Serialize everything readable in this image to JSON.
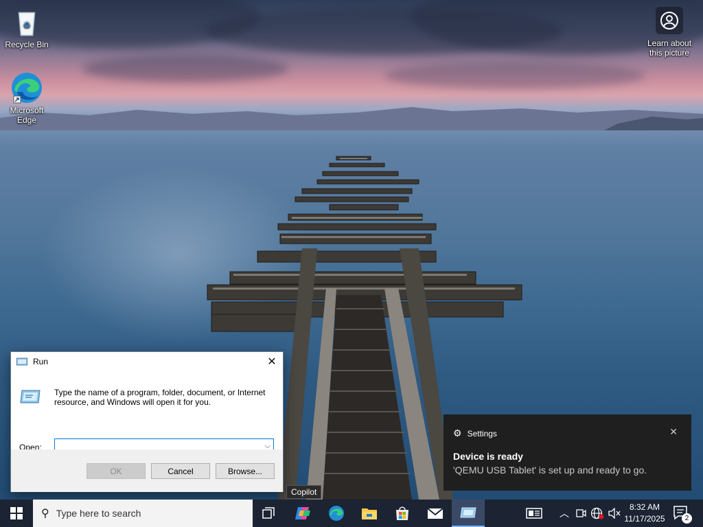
{
  "desktop": {
    "icons": [
      {
        "label": "Recycle Bin"
      },
      {
        "label": "Microsoft Edge"
      },
      {
        "label": "Learn about this picture"
      }
    ]
  },
  "run_dialog": {
    "title": "Run",
    "description": "Type the name of a program, folder, document, or Internet resource, and Windows will open it for you.",
    "open_label_accel": "O",
    "open_label_rest": "pen:",
    "open_value": "",
    "ok_label": "OK",
    "cancel_label": "Cancel",
    "browse_label": "Browse..."
  },
  "toast": {
    "app": "Settings",
    "title": "Device is ready",
    "body": "'QEMU USB Tablet' is set up and ready to go."
  },
  "tooltip": {
    "text": "Copilot"
  },
  "taskbar": {
    "search_placeholder": "Type here to search",
    "pinned": [
      "Task View",
      "Copilot",
      "Microsoft Edge",
      "File Explorer",
      "Microsoft Store",
      "Mail",
      "Run"
    ],
    "active_app": "Run",
    "clock_time": "8:32 AM",
    "clock_date": "11/17/2025",
    "notification_count": "2"
  },
  "colors": {
    "taskbar_bg": "#1c2333",
    "accent": "#0078d4",
    "toast_bg": "#1f1f1f"
  }
}
